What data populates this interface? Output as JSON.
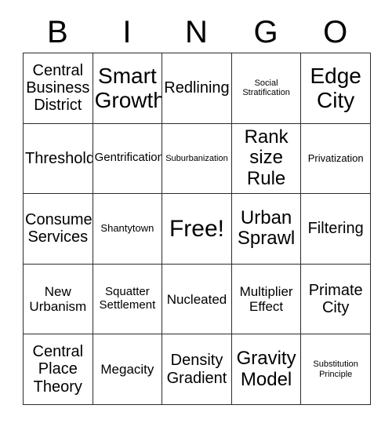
{
  "card": {
    "header_letters": [
      "B",
      "I",
      "N",
      "G",
      "O"
    ],
    "rows": [
      [
        {
          "text": "Central Business District",
          "size": "fs-xl"
        },
        {
          "text": "Smart Growth",
          "size": "fs-3xl"
        },
        {
          "text": "Redlining",
          "size": "fs-xl"
        },
        {
          "text": "Social Stratification",
          "size": "fs-xs"
        },
        {
          "text": "Edge City",
          "size": "fs-3xl"
        }
      ],
      [
        {
          "text": "Threshold",
          "size": "fs-xl"
        },
        {
          "text": "Gentrification",
          "size": "fs-md"
        },
        {
          "text": "Suburbanization",
          "size": "fs-xs"
        },
        {
          "text": "Rank size Rule",
          "size": "fs-2xl"
        },
        {
          "text": "Privatization",
          "size": "fs-sm"
        }
      ],
      [
        {
          "text": "Consumer Services",
          "size": "fs-xl"
        },
        {
          "text": "Shantytown",
          "size": "fs-sm"
        },
        {
          "text": "Free!",
          "size": "fs-free"
        },
        {
          "text": "Urban Sprawl",
          "size": "fs-2xl"
        },
        {
          "text": "Filtering",
          "size": "fs-xl"
        }
      ],
      [
        {
          "text": "New Urbanism",
          "size": "fs-lg"
        },
        {
          "text": "Squatter Settlement",
          "size": "fs-md"
        },
        {
          "text": "Nucleated",
          "size": "fs-lg"
        },
        {
          "text": "Multiplier Effect",
          "size": "fs-lg"
        },
        {
          "text": "Primate City",
          "size": "fs-xl"
        }
      ],
      [
        {
          "text": "Central Place Theory",
          "size": "fs-xl"
        },
        {
          "text": "Megacity",
          "size": "fs-lg"
        },
        {
          "text": "Density Gradient",
          "size": "fs-xl"
        },
        {
          "text": "Gravity Model",
          "size": "fs-2xl"
        },
        {
          "text": "Substitution Principle",
          "size": "fs-xs"
        }
      ]
    ]
  }
}
